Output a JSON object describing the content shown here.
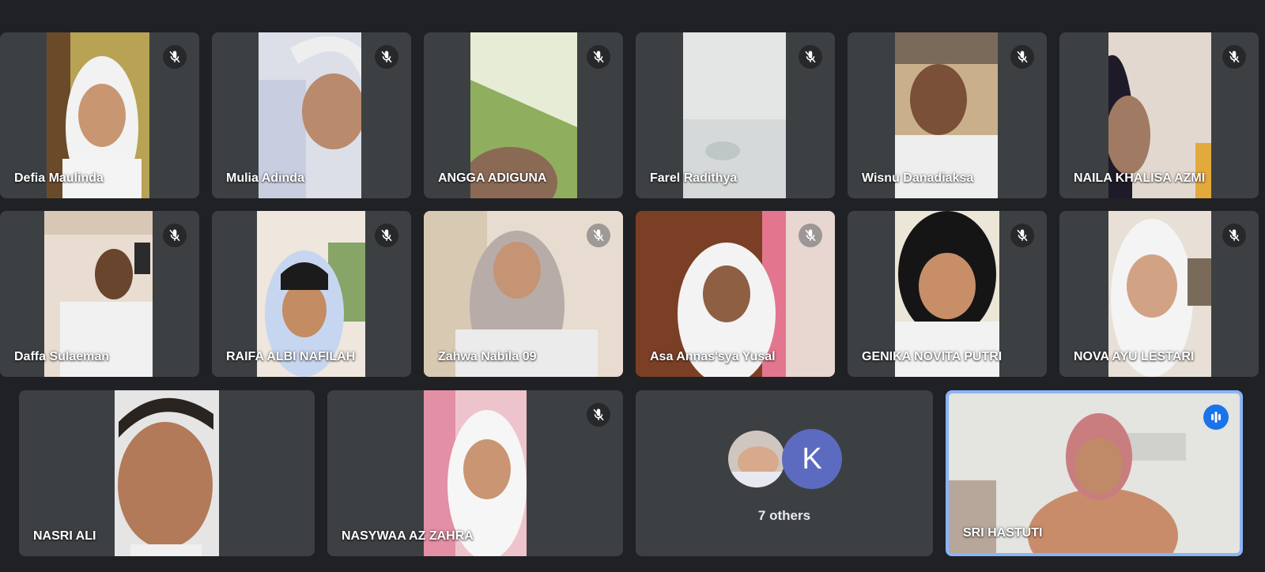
{
  "participants_row1": [
    {
      "name": "Defia Maulinda",
      "muted": true
    },
    {
      "name": "Mulia Adinda",
      "muted": true
    },
    {
      "name": "ANGGA ADIGUNA",
      "muted": true
    },
    {
      "name": "Farel Radithya",
      "muted": true
    },
    {
      "name": "Wisnu Danadiaksa",
      "muted": true
    },
    {
      "name": "NAILA KHALISA AZMI",
      "muted": true
    }
  ],
  "participants_row2": [
    {
      "name": "Daffa Sulaeman",
      "muted": true
    },
    {
      "name": "RAIFA ALBI NAFILAH",
      "muted": true
    },
    {
      "name": "Zahwa Nabila 09",
      "muted": true
    },
    {
      "name": "Asa Annas'sya Yusal",
      "muted": true
    },
    {
      "name": "GENIKA NOVITA PUTRI",
      "muted": true
    },
    {
      "name": "NOVA AYU LESTARI",
      "muted": true
    }
  ],
  "participants_row3": [
    {
      "name": "NASRI ALI",
      "muted": false
    },
    {
      "name": "NASYWAA AZ ZAHRA",
      "muted": true
    }
  ],
  "others": {
    "avatar_letter": "K",
    "label": "7 others"
  },
  "active_speaker": {
    "name": "SRI HASTUTI",
    "speaking": true
  },
  "colors": {
    "background": "#202124",
    "tile": "#3c4043",
    "active_border": "#8ab4f8",
    "speaking_badge": "#1a73e8",
    "avatar_k": "#5c6bc0"
  },
  "icons": {
    "muted": "mic-off-icon",
    "speaking": "audio-level-icon"
  }
}
